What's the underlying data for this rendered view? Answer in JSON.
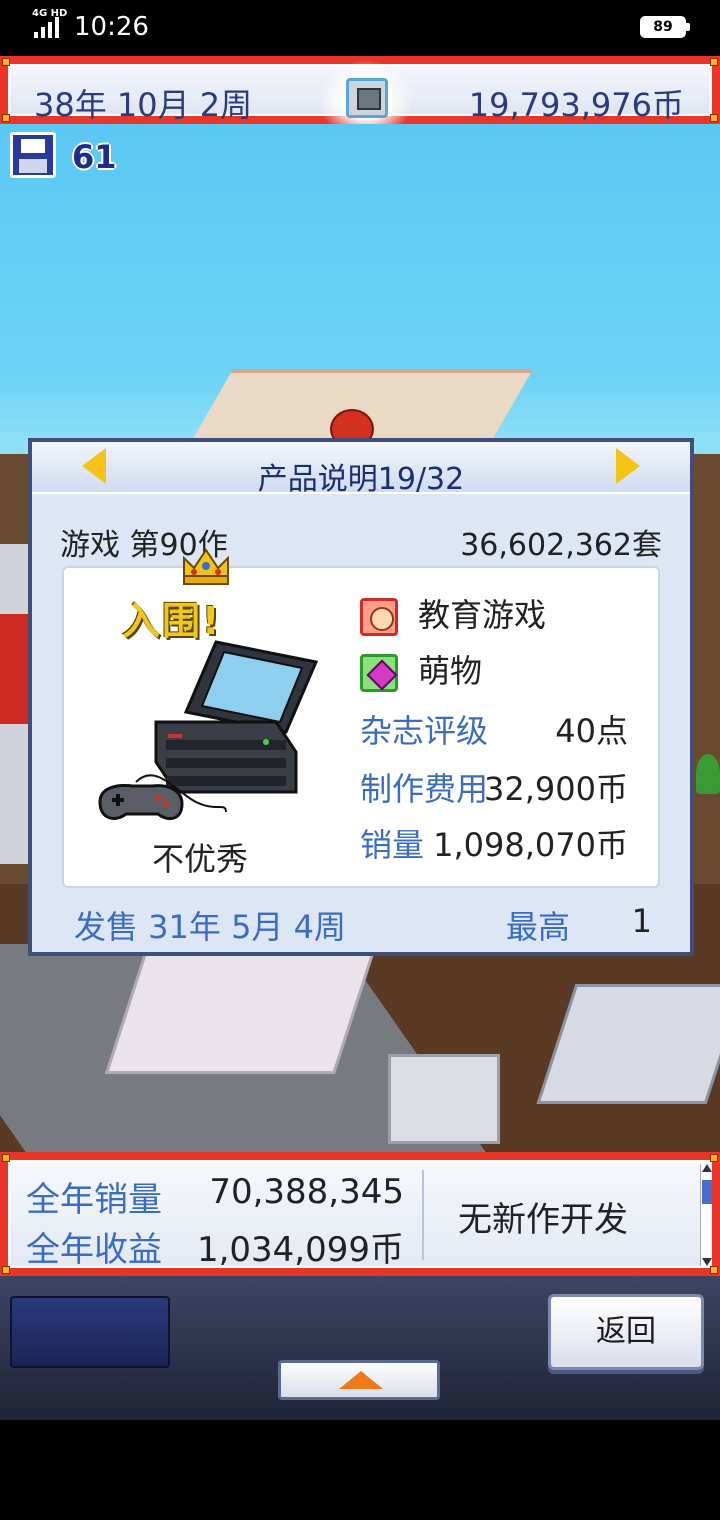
{
  "status_bar": {
    "network": "4G HD",
    "time": "10:26",
    "battery": "89"
  },
  "top_bar": {
    "date": "38年 10月 2周",
    "money": "19,793,976币"
  },
  "save": {
    "count": "61"
  },
  "product_panel": {
    "title": "产品说明19/32",
    "game_label": "游戏 第90作",
    "total_sales": "36,602,362套",
    "nominee_badge": "入围!",
    "verdict": "不优秀",
    "genre": "教育游戏",
    "theme": "萌物",
    "rating_label": "杂志评级",
    "rating_value": "40点",
    "cost_label": "制作费用",
    "cost_value": "32,900币",
    "revenue_label": "销量",
    "revenue_value": "1,098,070币",
    "release": "发售 31年 5月 4周",
    "best_label": "最高",
    "best_value": "1"
  },
  "summary": {
    "annual_sales_label": "全年销量",
    "annual_sales_value": "70,388,345",
    "annual_revenue_label": "全年收益",
    "annual_revenue_value": "1,034,099币",
    "dev_status": "无新作开发"
  },
  "controls": {
    "back_label": "返回"
  },
  "colors": {
    "frame_red": "#e8362a",
    "label_blue": "#3a6cc2",
    "title_navy": "#1d2e6e",
    "arrow_gold": "#f4c316",
    "up_arrow_orange": "#ee7a1c"
  }
}
